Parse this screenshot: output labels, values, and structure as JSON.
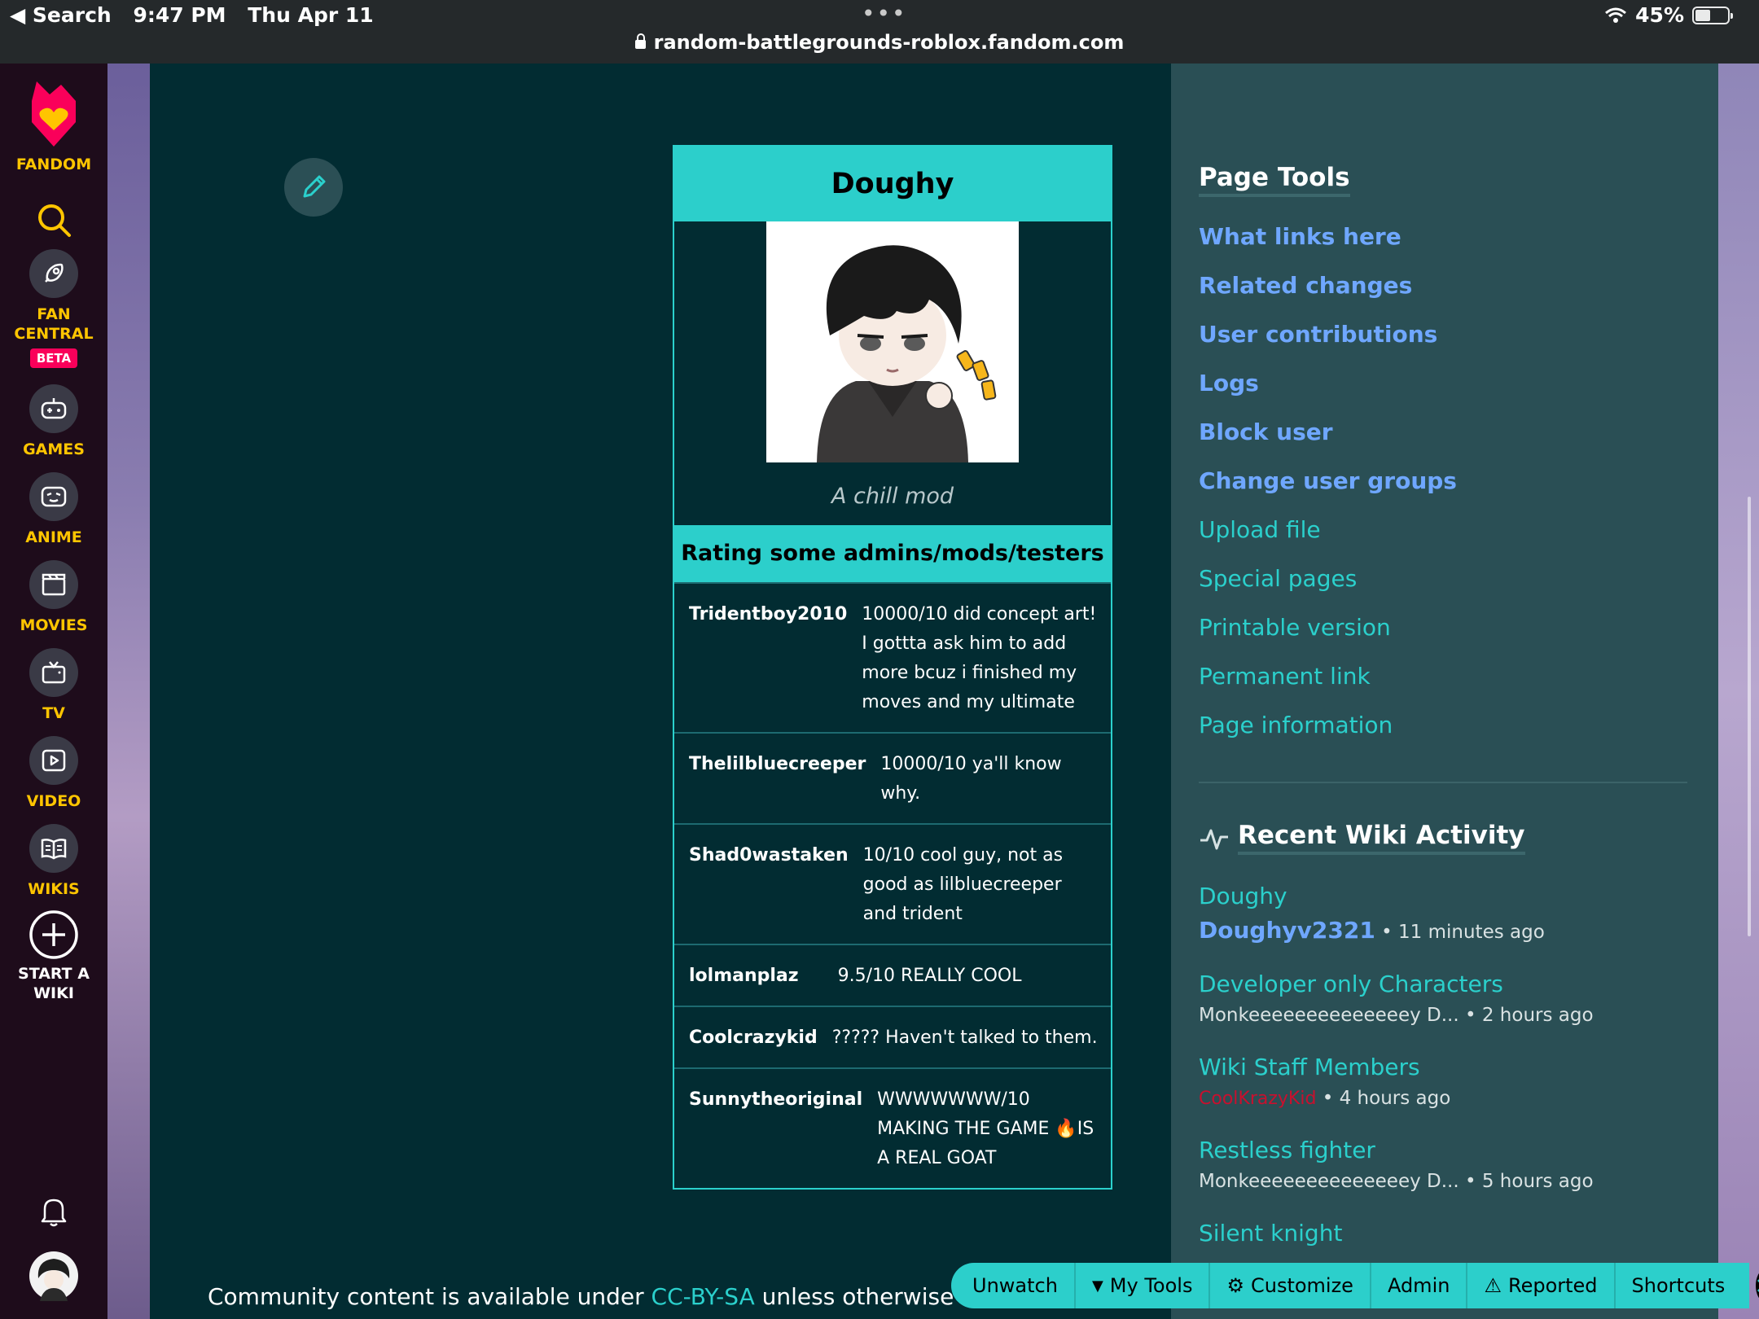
{
  "status_bar": {
    "back_label": "◀ Search",
    "time": "9:47 PM",
    "date": "Thu Apr 11",
    "url": "random-battlegrounds-roblox.fandom.com",
    "battery": "45%"
  },
  "rail": {
    "brand": "FANDOM",
    "items": [
      {
        "label": "FAN CENTRAL",
        "badge": "BETA"
      },
      {
        "label": "GAMES"
      },
      {
        "label": "ANIME"
      },
      {
        "label": "MOVIES"
      },
      {
        "label": "TV"
      },
      {
        "label": "VIDEO"
      },
      {
        "label": "WIKIS"
      },
      {
        "label": "START A WIKI"
      }
    ]
  },
  "infobox": {
    "title": "Doughy",
    "caption": "A chill mod",
    "subheading": "Rating some admins/mods/testers",
    "rows": [
      {
        "name": "Tridentboy2010",
        "value": "10000/10 did concept art! I gottta ask him to add more bcuz i finished my moves and my ultimate"
      },
      {
        "name": "Thelilbluecreeper",
        "value": "10000/10 ya'll know why."
      },
      {
        "name": "Shad0wastaken",
        "value": "10/10 cool guy, not as good as lilbluecreeper and trident"
      },
      {
        "name": "lolmanplaz",
        "value": "9.5/10 REALLY COOL"
      },
      {
        "name": "Coolcrazykid",
        "value": "????? Haven't talked to them."
      },
      {
        "name": "Sunnytheoriginal",
        "value": "WWWWWWW/10 MAKING THE GAME 🔥IS A REAL GOAT"
      }
    ]
  },
  "footer": {
    "prefix": "Community content is available under ",
    "license": "CC-BY-SA",
    "suffix": " unless otherwise noted."
  },
  "page_tools": {
    "heading": "Page Tools",
    "links": [
      {
        "label": "What links here",
        "style": "bold"
      },
      {
        "label": "Related changes",
        "style": "bold"
      },
      {
        "label": "User contributions",
        "style": "bold"
      },
      {
        "label": "Logs",
        "style": "bold"
      },
      {
        "label": "Block user",
        "style": "bold"
      },
      {
        "label": "Change user groups",
        "style": "bold"
      },
      {
        "label": "Upload file",
        "style": "plain"
      },
      {
        "label": "Special pages",
        "style": "plain"
      },
      {
        "label": "Printable version",
        "style": "plain"
      },
      {
        "label": "Permanent link",
        "style": "plain"
      },
      {
        "label": "Page information",
        "style": "plain"
      }
    ]
  },
  "recent_activity": {
    "heading": "Recent Wiki Activity",
    "items": [
      {
        "title": "Doughy",
        "user": "Doughyv2321",
        "time": "• 11 minutes ago"
      },
      {
        "title": "Developer only Characters",
        "user": "Monkeeeeeeeeeeeeeey D...",
        "time": "• 2 hours ago"
      },
      {
        "title": "Wiki Staff Members",
        "user": "CoolKrazyKid",
        "time": "• 4 hours ago"
      },
      {
        "title": "Restless fighter",
        "user": "Monkeeeeeeeeeeeeeey D...",
        "time": "• 5 hours ago"
      },
      {
        "title": "Silent knight",
        "user": "",
        "time": ""
      }
    ]
  },
  "toolbar": {
    "unwatch": "Unwatch",
    "my_tools": "My Tools",
    "customize": "Customize",
    "admin": "Admin",
    "reported": "Reported",
    "shortcuts": "Shortcuts"
  }
}
